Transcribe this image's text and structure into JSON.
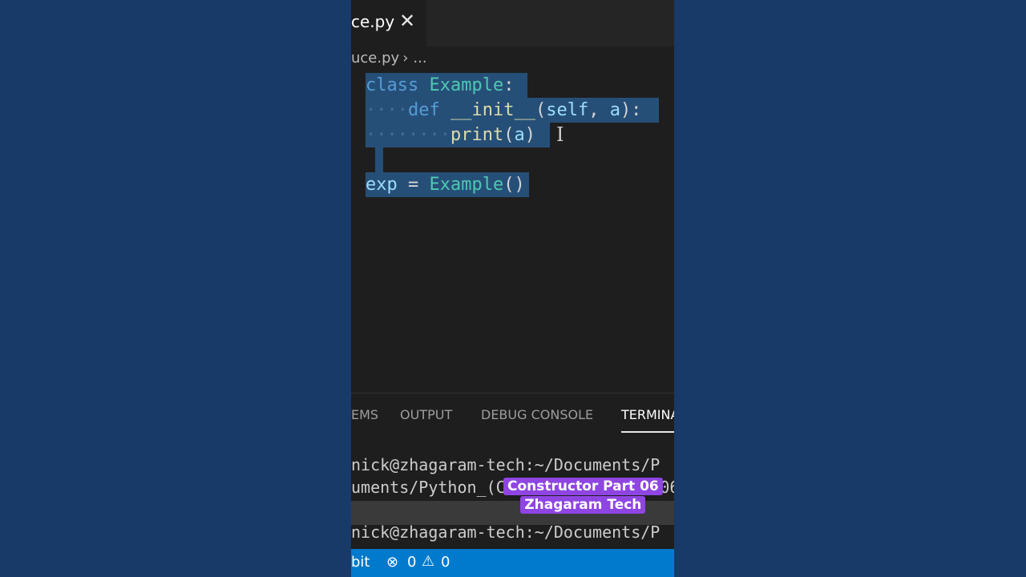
{
  "editor": {
    "tab": {
      "label": "ce.py",
      "close_icon": "close-icon"
    },
    "breadcrumb": {
      "file": "uce.py",
      "more": "..."
    },
    "code_lines": [
      "class Example:",
      "    def __init__(self, a):",
      "        print(a)",
      "",
      "exp = Example()"
    ]
  },
  "panel": {
    "tabs": [
      "EMS",
      "OUTPUT",
      "DEBUG CONSOLE",
      "TERMINA"
    ],
    "active_tab": "TERMINA",
    "terminal_lines": [
      "nick@zhagaram-tech:~/Documents/P",
      "uments/Python_(Constructor Part 06du",
      "nick@zhagaram-tech:~/Documents/P"
    ]
  },
  "overlay": {
    "caption_line1": "Constructor Part 06",
    "caption_line2": "Zhagaram Tech"
  },
  "statusbar": {
    "git_label": "bit",
    "errors": "0",
    "warnings": "0"
  },
  "colors": {
    "background": "#173a68",
    "editor_bg": "#1e1e1e",
    "selection": "#264f78",
    "statusbar": "#007acc",
    "caption_bg": "#8f45e2"
  }
}
